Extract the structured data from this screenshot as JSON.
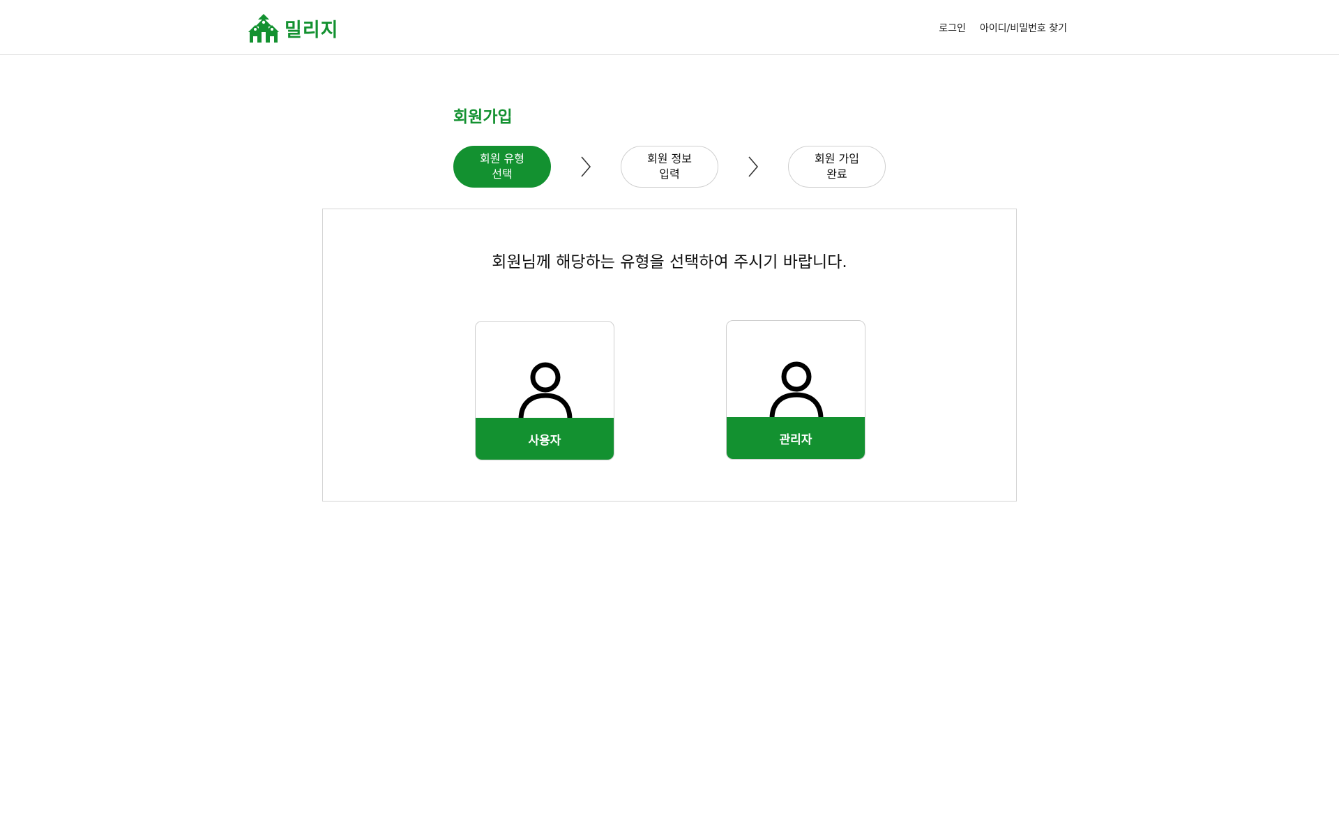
{
  "brand": {
    "name": "밀리지",
    "logo_icon": "house-icon",
    "color": "#139130"
  },
  "nav": {
    "login": "로그인",
    "find_account": "아이디/비밀번호 찾기"
  },
  "page": {
    "title": "회원가입"
  },
  "steps": [
    {
      "line1": "회원 유형",
      "line2": "선택",
      "active": true
    },
    {
      "line1": "회원 정보",
      "line2": "입력",
      "active": false
    },
    {
      "line1": "회원 가입",
      "line2": "완료",
      "active": false
    }
  ],
  "step_separator_icon": "chevron-right-icon",
  "selection": {
    "instruction": "회원님께 해당하는 유형을 선택하여 주시기 바랍니다.",
    "options": [
      {
        "label": "사용자",
        "icon": "person-icon"
      },
      {
        "label": "관리자",
        "icon": "person-icon"
      }
    ]
  }
}
